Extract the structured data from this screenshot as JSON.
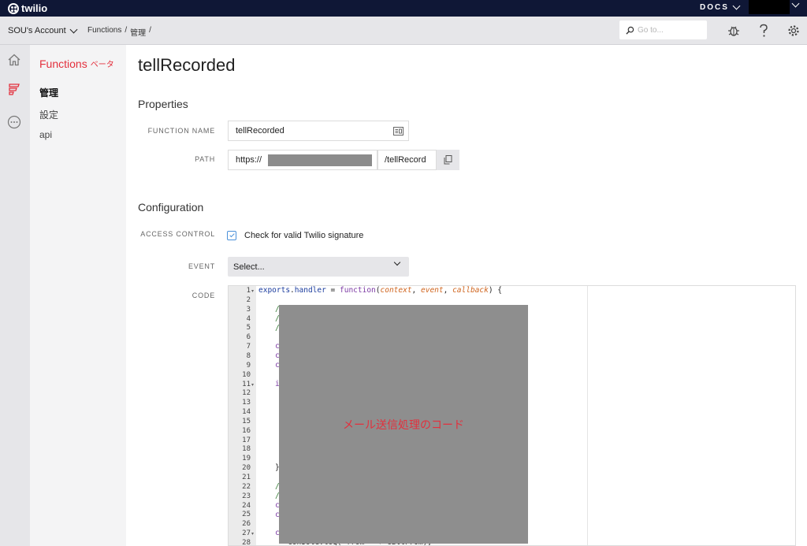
{
  "brand": {
    "name": "twilio"
  },
  "topbar": {
    "docs_label": "DOCS"
  },
  "subbar": {
    "account": "SOU's Account",
    "breadcrumbs": [
      "Functions",
      "/",
      "管理",
      "/"
    ],
    "search_placeholder": "Go to..."
  },
  "nav": {
    "title": "Functions",
    "beta": "ベータ",
    "items": [
      "管理",
      "設定",
      "api"
    ]
  },
  "page": {
    "title": "tellRecorded",
    "properties_heading": "Properties",
    "function_name_label": "FUNCTION NAME",
    "function_name_value": "tellRecorded",
    "path_label": "PATH",
    "path_prefix": "https://",
    "path_suffix": "/tellRecord",
    "configuration_heading": "Configuration",
    "access_control_label": "ACCESS CONTROL",
    "access_control_check": "Check for valid Twilio signature",
    "event_label": "EVENT",
    "event_value": "Select...",
    "code_label": "CODE"
  },
  "editor": {
    "line_numbers": [
      "1",
      "2",
      "3",
      "4",
      "5",
      "6",
      "7",
      "8",
      "9",
      "10",
      "11",
      "12",
      "13",
      "14",
      "15",
      "16",
      "17",
      "18",
      "19",
      "20",
      "21",
      "22",
      "23",
      "24",
      "25",
      "26",
      "27",
      "28"
    ],
    "line1": {
      "ident1": "exports",
      "ident2": "handler",
      "fn": "function",
      "p1": "context",
      "p2": "event",
      "p3": "callback"
    },
    "fragments": {
      "l3": "/",
      "l4": "/",
      "l5": "/",
      "l7": "c",
      "l8": "c",
      "l9": "c",
      "l11": "i",
      "l20": "}",
      "l22": "/",
      "l23": "/",
      "l24": "c",
      "l25": "c",
      "l27": "c",
      "l28": "console.log(\"from \" + callFrom);"
    },
    "redaction_note": "メール送信処理のコード"
  },
  "colors": {
    "accent": "#e3303d",
    "topbar": "#0f1736",
    "checkbox": "#4a90d9"
  },
  "icons": [
    "home-icon",
    "functions-icon",
    "more-icon",
    "search-icon",
    "debugger-icon",
    "help-icon",
    "settings-icon",
    "copy-icon",
    "id-card-icon"
  ]
}
